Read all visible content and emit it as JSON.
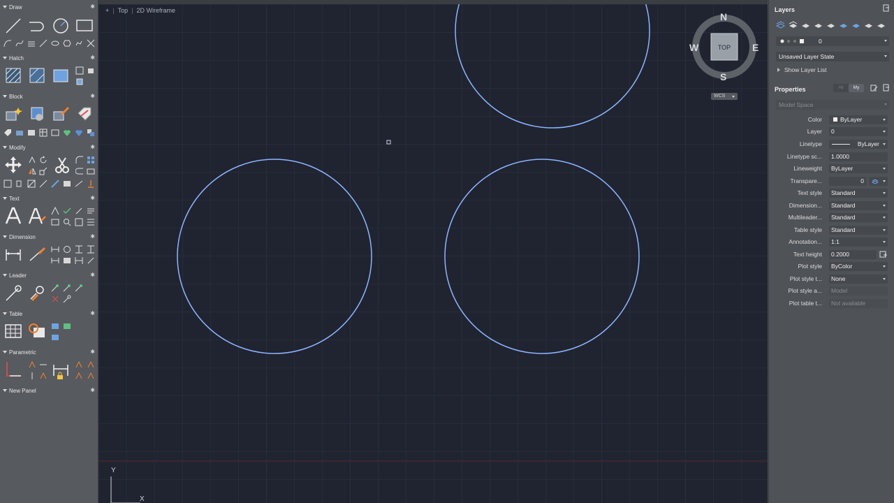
{
  "left_palette": {
    "sections": [
      {
        "title": "Draw"
      },
      {
        "title": "Hatch"
      },
      {
        "title": "Block"
      },
      {
        "title": "Modify"
      },
      {
        "title": "Text"
      },
      {
        "title": "Dimension"
      },
      {
        "title": "Leader"
      },
      {
        "title": "Table"
      },
      {
        "title": "Parametric"
      },
      {
        "title": "New Panel"
      }
    ]
  },
  "viewport": {
    "label_plus": "+",
    "label_view": "Top",
    "label_style": "2D Wireframe",
    "viewcube": {
      "n": "N",
      "s": "S",
      "e": "E",
      "w": "W",
      "face": "TOP",
      "wcs": "WCS"
    },
    "ucs": {
      "y": "Y",
      "x": "X"
    }
  },
  "layers": {
    "title": "Layers",
    "current_layer": "0",
    "layer_state": "Unsaved Layer State",
    "show_list": "Show Layer List"
  },
  "properties": {
    "title": "Properties",
    "tab_all": "All",
    "tab_my": "My",
    "space": "Model Space",
    "rows": [
      {
        "label": "Color",
        "value": "ByLayer"
      },
      {
        "label": "Layer",
        "value": "0"
      },
      {
        "label": "Linetype",
        "value": "ByLayer"
      },
      {
        "label": "Linetype sc...",
        "value": "1.0000"
      },
      {
        "label": "Lineweight",
        "value": "ByLayer"
      },
      {
        "label": "Transpare...",
        "value": "0"
      },
      {
        "label": "Text style",
        "value": "Standard"
      },
      {
        "label": "Dimension...",
        "value": "Standard"
      },
      {
        "label": "Multileader...",
        "value": "Standard"
      },
      {
        "label": "Table style",
        "value": "Standard"
      },
      {
        "label": "Annotation...",
        "value": "1:1"
      },
      {
        "label": "Text height",
        "value": "0.2000"
      },
      {
        "label": "Plot style",
        "value": "ByColor"
      },
      {
        "label": "Plot style t...",
        "value": "None"
      },
      {
        "label": "Plot style a...",
        "value": "Model"
      },
      {
        "label": "Plot table t...",
        "value": "Not available"
      }
    ]
  }
}
